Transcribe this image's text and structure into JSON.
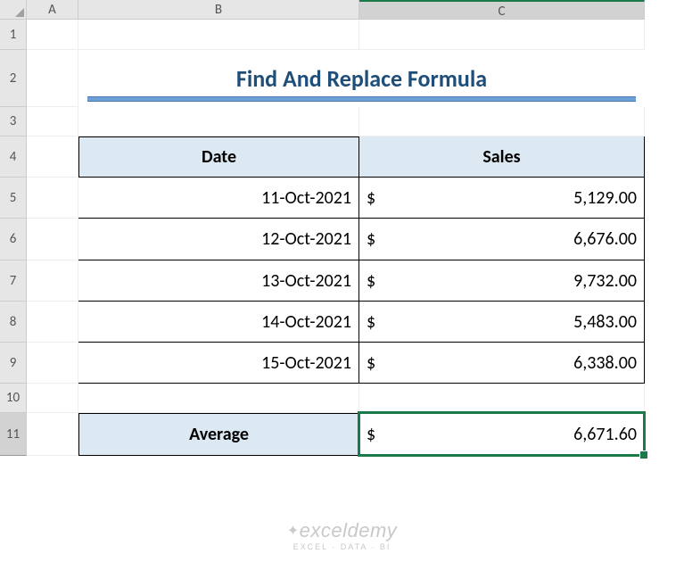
{
  "cols": [
    "A",
    "B",
    "C"
  ],
  "rows": [
    "1",
    "2",
    "3",
    "4",
    "5",
    "6",
    "7",
    "8",
    "9",
    "10",
    "11"
  ],
  "title": "Find And Replace Formula",
  "headers": {
    "date": "Date",
    "sales": "Sales"
  },
  "data": [
    {
      "date": "11-Oct-2021",
      "cur": "$",
      "val": "5,129.00"
    },
    {
      "date": "12-Oct-2021",
      "cur": "$",
      "val": "6,676.00"
    },
    {
      "date": "13-Oct-2021",
      "cur": "$",
      "val": "9,732.00"
    },
    {
      "date": "14-Oct-2021",
      "cur": "$",
      "val": "5,483.00"
    },
    {
      "date": "15-Oct-2021",
      "cur": "$",
      "val": "6,338.00"
    }
  ],
  "average": {
    "label": "Average",
    "cur": "$",
    "val": "6,671.60"
  },
  "watermark": {
    "brand": "exceldemy",
    "tag": "EXCEL · DATA · BI"
  }
}
